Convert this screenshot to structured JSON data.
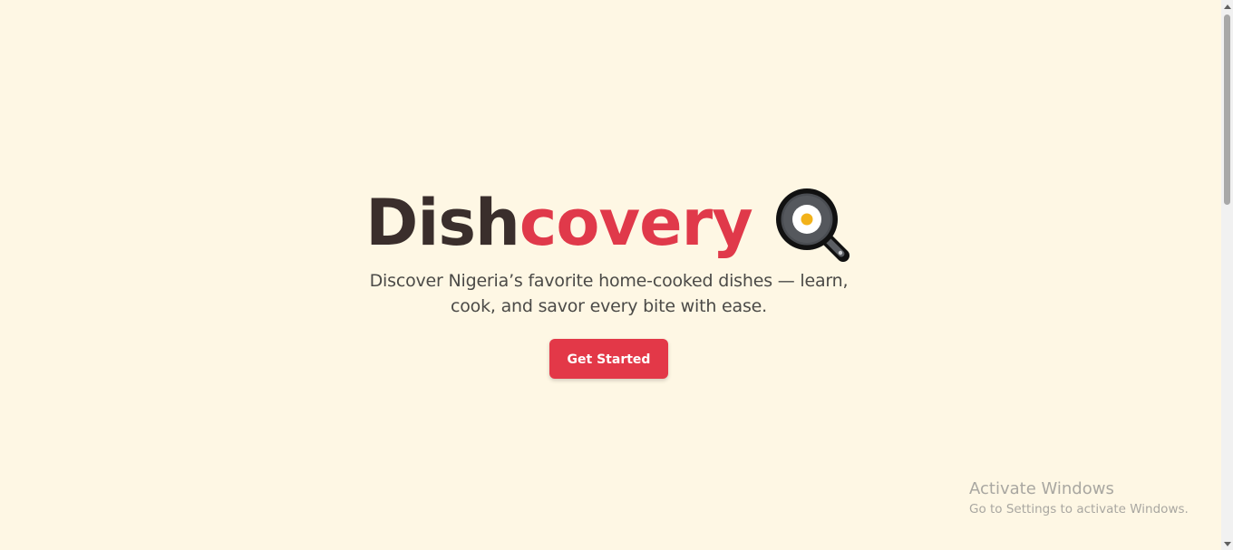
{
  "hero": {
    "title_part1": "Dish",
    "title_part2": "covery",
    "logo_icon": "frying-pan-egg-icon",
    "subtitle": "Discover Nigeria’s favorite home-cooked dishes — learn, cook, and savor every bite with ease.",
    "cta_label": "Get Started"
  },
  "watermark": {
    "line1": "Activate Windows",
    "line2": "Go to Settings to activate Windows."
  },
  "colors": {
    "background": "#fef7e4",
    "title_dark": "#3a2e2c",
    "accent": "#e0394a",
    "button": "#e33848"
  }
}
